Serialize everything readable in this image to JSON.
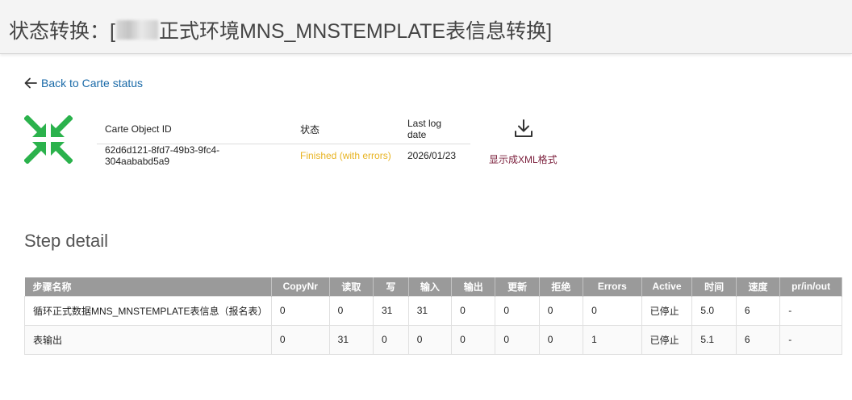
{
  "header": {
    "title_prefix": "状态转换：[",
    "title_suffix": "正式环境MNS_MNSTEMPLATE表信息转换]"
  },
  "back_link": {
    "label": "Back to Carte status"
  },
  "status": {
    "columns": [
      "Carte Object ID",
      "状态",
      "Last log date"
    ],
    "object_id": "62d6d121-8fd7-49b3-9fc4-304aababd5a9",
    "state": "Finished (with errors)",
    "last_log_date": "2026/01/23",
    "xml_link": "显示成XML格式",
    "icon": "compress-arrows-icon",
    "icon_color": "#2bb24c",
    "state_color": "#e8b321"
  },
  "step_detail": {
    "title": "Step detail",
    "columns": [
      "步骤名称",
      "CopyNr",
      "读取",
      "写",
      "输入",
      "输出",
      "更新",
      "拒绝",
      "Errors",
      "Active",
      "时间",
      "速度",
      "pr/in/out"
    ],
    "rows": [
      [
        "循环正式数据MNS_MNSTEMPLATE表信息（报名表）",
        "0",
        "0",
        "31",
        "31",
        "0",
        "0",
        "0",
        "0",
        "已停止",
        "5.0",
        "6",
        "-"
      ],
      [
        "表输出",
        "0",
        "31",
        "0",
        "0",
        "0",
        "0",
        "0",
        "1",
        "已停止",
        "5.1",
        "6",
        "-"
      ]
    ]
  }
}
